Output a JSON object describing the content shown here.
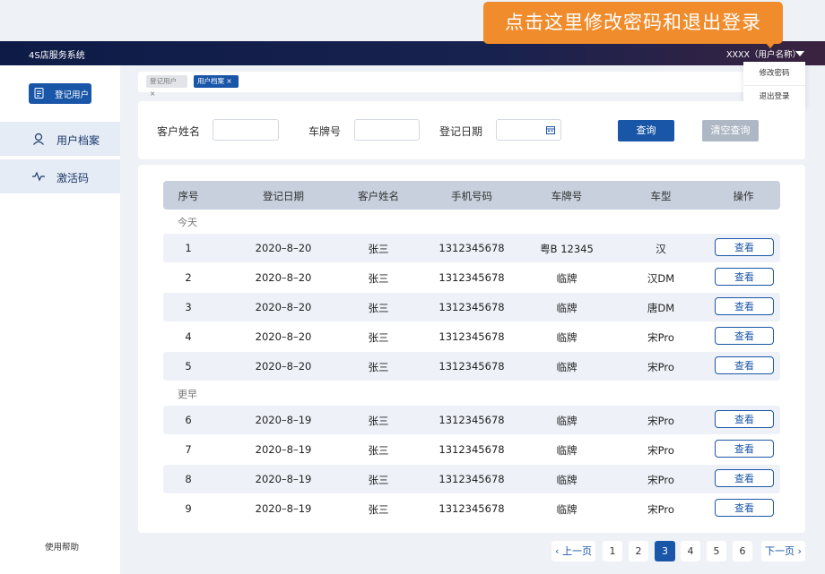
{
  "header": {
    "app_title": "4S店服务系统",
    "user_name": "XXXX（用户名称）"
  },
  "callout": {
    "text": "点击这里修改密码和退出登录"
  },
  "user_menu": {
    "items": [
      "修改密码",
      "退出登录"
    ]
  },
  "sidebar": {
    "register_button": "登记用户",
    "items": [
      {
        "label": "用户档案",
        "icon": "user-icon"
      },
      {
        "label": "激活码",
        "icon": "pulse-icon"
      }
    ],
    "help": "使用帮助"
  },
  "tabs": [
    {
      "label": "登记用户 ×"
    },
    {
      "label": "用户档案 ×"
    }
  ],
  "search": {
    "fields": [
      {
        "label": "客户姓名"
      },
      {
        "label": "车牌号"
      },
      {
        "label": "登记日期"
      }
    ],
    "query_button": "查询",
    "clear_button": "清空查询"
  },
  "table": {
    "headers": [
      "序号",
      "登记日期",
      "客户姓名",
      "手机号码",
      "车牌号",
      "车型",
      "操作"
    ],
    "groups": [
      {
        "label": "今天",
        "rows": [
          [
            "1",
            "2020–8–20",
            "张三",
            "1312345678",
            "粤B 12345",
            "汉",
            "查看"
          ],
          [
            "2",
            "2020–8–20",
            "张三",
            "1312345678",
            "临牌",
            "汉DM",
            "查看"
          ],
          [
            "3",
            "2020–8–20",
            "张三",
            "1312345678",
            "临牌",
            "唐DM",
            "查看"
          ],
          [
            "4",
            "2020–8–20",
            "张三",
            "1312345678",
            "临牌",
            "宋Pro",
            "查看"
          ],
          [
            "5",
            "2020–8–20",
            "张三",
            "1312345678",
            "临牌",
            "宋Pro",
            "查看"
          ]
        ]
      },
      {
        "label": "更早",
        "rows": [
          [
            "6",
            "2020–8–19",
            "张三",
            "1312345678",
            "临牌",
            "宋Pro",
            "查看"
          ],
          [
            "7",
            "2020–8–19",
            "张三",
            "1312345678",
            "临牌",
            "宋Pro",
            "查看"
          ],
          [
            "8",
            "2020–8–19",
            "张三",
            "1312345678",
            "临牌",
            "宋Pro",
            "查看"
          ],
          [
            "9",
            "2020–8–19",
            "张三",
            "1312345678",
            "临牌",
            "宋Pro",
            "查看"
          ]
        ]
      }
    ]
  },
  "pagination": {
    "prev": "‹ 上一页",
    "next": "下一页 ›",
    "pages": [
      "1",
      "2",
      "3",
      "4",
      "5",
      "6"
    ],
    "current": "3"
  },
  "colors": {
    "primary": "#1a56a8",
    "accent": "#f08c2c",
    "header_bg": "#0e1b47",
    "row_shade": "#eef2f8"
  }
}
